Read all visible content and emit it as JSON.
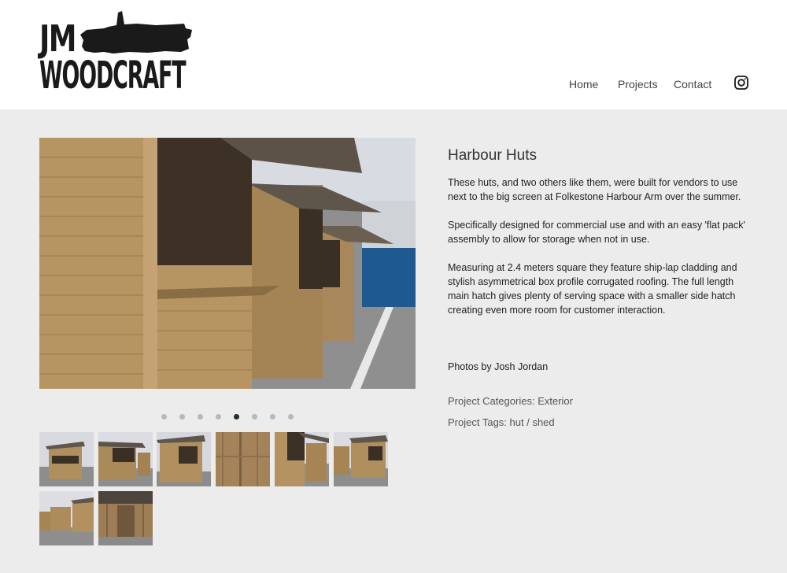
{
  "brand": {
    "line1": "JM",
    "line2": "WOODCRAFT"
  },
  "nav": {
    "items": [
      "Home",
      "Projects",
      "Contact"
    ],
    "social_icon": "instagram-icon"
  },
  "project": {
    "title": "Harbour Huts",
    "paragraphs": [
      "These huts, and two others like them, were built for vendors to use next to the big screen at Folkestone Harbour Arm over the summer.",
      "Specifically designed for commercial use and with an easy 'flat pack' assembly to allow for storage when not in use.",
      "Measuring at 2.4 meters square they feature ship-lap cladding and stylish asymmetrical box profile corrugated roofing. The full length main hatch gives plenty of serving space with a smaller side hatch creating even more room for customer interaction."
    ],
    "credit": "Photos by Josh Jordan",
    "categories_label": "Project Categories:",
    "categories_value": "Exterior",
    "tags_label": "Project Tags:",
    "tags_value": "hut / shed"
  },
  "gallery": {
    "slide_count": 8,
    "active_slide": 4,
    "thumbnail_count": 8
  },
  "colors": {
    "background": "#ececed",
    "header": "#ffffff",
    "text": "#222222",
    "wood": "#a8875a"
  }
}
